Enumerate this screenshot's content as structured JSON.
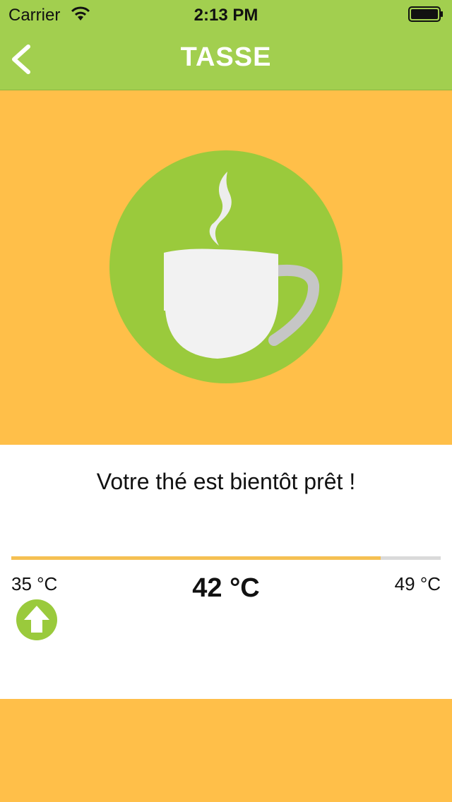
{
  "status_bar": {
    "carrier": "Carrier",
    "time": "2:13 PM"
  },
  "nav": {
    "title": "TASSE",
    "back_icon": "chevron-left-icon"
  },
  "hero": {
    "icon": "tea-cup-icon"
  },
  "message": "Votre thé est bientôt prêt !",
  "temperature": {
    "min_label": "35 °C",
    "current_label": "42 °C",
    "max_label": "49 °C",
    "min": 35,
    "current": 42,
    "max": 49,
    "progress": 0.86
  },
  "up_button": {
    "icon": "arrow-up-icon"
  },
  "colors": {
    "header": "#a2cf4f",
    "background": "#ffbf49",
    "circle": "#9ACA3C",
    "progress_fill": "#f5c052",
    "progress_track": "#dadada"
  }
}
